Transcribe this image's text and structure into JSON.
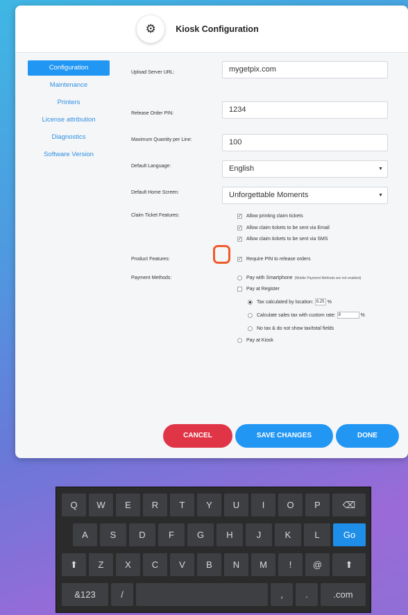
{
  "header": {
    "title": "Kiosk Configuration",
    "icon": "gear-icon"
  },
  "sidebar": {
    "items": [
      {
        "label": "Configuration"
      },
      {
        "label": "Maintenance"
      },
      {
        "label": "Printers"
      },
      {
        "label": "License attribution"
      },
      {
        "label": "Diagnostics"
      },
      {
        "label": "Software Version"
      }
    ]
  },
  "form": {
    "upload_url": {
      "label": "Upload Server URL:",
      "value": "mygetpix.com"
    },
    "release_pin": {
      "label": "Release Order PIN:",
      "value": "1234"
    },
    "max_qty": {
      "label": "Maximum Quantity per Line:",
      "value": "100"
    },
    "language": {
      "label": "Default Language:",
      "value": "English"
    },
    "home_screen": {
      "label": "Default Home Screen:",
      "value": "Unforgettable Moments"
    },
    "claim_ticket": {
      "label": "Claim Ticket Features:",
      "options": [
        {
          "label": "Allow printing claim tickets",
          "checked": true
        },
        {
          "label": "Allow claim tickets to be sent via Email",
          "checked": true
        },
        {
          "label": "Allow claim tickets to be sent via SMS",
          "checked": true
        }
      ]
    },
    "product_features": {
      "label": "Product Features:",
      "option": {
        "label": "Require PIN to release orders",
        "checked": true
      }
    },
    "payment": {
      "label": "Payment Methods:",
      "smartphone": {
        "label": "Pay with Smartphone",
        "note": "(Mobile Payment Methods are not enabled)"
      },
      "register": {
        "label": "Pay at Register"
      },
      "tax_location": {
        "label": "Tax calculated by location:",
        "value": "6.25",
        "suffix": "%"
      },
      "tax_custom": {
        "label": "Calculate sales tax with custom rate:",
        "value": "8",
        "suffix": "%"
      },
      "no_tax": {
        "label": "No tax & do not show tax/total fields"
      },
      "kiosk": {
        "label": "Pay at Kiosk"
      }
    }
  },
  "buttons": {
    "cancel": "CANCEL",
    "save": "SAVE CHANGES",
    "done": "DONE"
  },
  "keyboard": {
    "row1": [
      "Q",
      "W",
      "E",
      "R",
      "T",
      "Y",
      "U",
      "I",
      "O",
      "P",
      "⌫"
    ],
    "row2": [
      "A",
      "S",
      "D",
      "F",
      "G",
      "H",
      "J",
      "K",
      "L",
      "Go"
    ],
    "row3": [
      "⬆",
      "Z",
      "X",
      "C",
      "V",
      "B",
      "N",
      "M",
      "!",
      "@",
      "⬆"
    ],
    "row4": [
      "&123",
      "/",
      " ",
      ",",
      ".",
      ".com"
    ]
  },
  "colors": {
    "accent": "#2196f3",
    "cancel": "#e03546",
    "highlight": "#f05a28"
  }
}
